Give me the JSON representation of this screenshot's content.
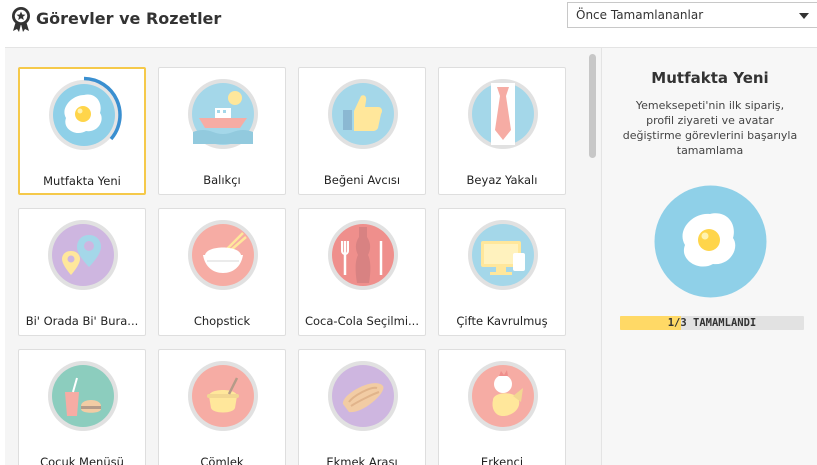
{
  "header": {
    "title": "Görevler ve Rozetler",
    "sort": {
      "selected": "Önce Tamamlananlar"
    }
  },
  "badges": [
    {
      "name": "Mutfakta Yeni",
      "icon": "fried-egg-icon",
      "selected": true
    },
    {
      "name": "Balıkçı",
      "icon": "fishing-boat-icon"
    },
    {
      "name": "Beğeni Avcısı",
      "icon": "thumbs-up-icon"
    },
    {
      "name": "Beyaz Yakalı",
      "icon": "necktie-icon"
    },
    {
      "name": "Bi' Orada Bi' Bura...",
      "icon": "map-pin-icon"
    },
    {
      "name": "Chopstick",
      "icon": "rice-bowl-icon"
    },
    {
      "name": "Coca-Cola Seçilmi...",
      "icon": "cola-bottle-icon"
    },
    {
      "name": "Çifte Kavrulmuş",
      "icon": "computer-screen-icon"
    },
    {
      "name": "Çocuk Menüsü",
      "icon": "kids-meal-icon"
    },
    {
      "name": "Çömlek",
      "icon": "clay-pot-icon"
    },
    {
      "name": "Ekmek Arası",
      "icon": "sandwich-icon"
    },
    {
      "name": "Erkenci",
      "icon": "rooster-icon"
    }
  ],
  "detail": {
    "title": "Mutfakta Yeni",
    "description": "Yemeksepeti'nin ilk sipariş, profil ziyareti ve avatar değiştirme görevlerini başarıyla tamamlama",
    "progress_text": "1/3 TAMAMLANDI",
    "progress_fraction": 0.333
  },
  "colors": {
    "selected_border": "#f5c94a",
    "progress_fill": "#ffd966",
    "progress_ring": "#3a8fd0"
  }
}
